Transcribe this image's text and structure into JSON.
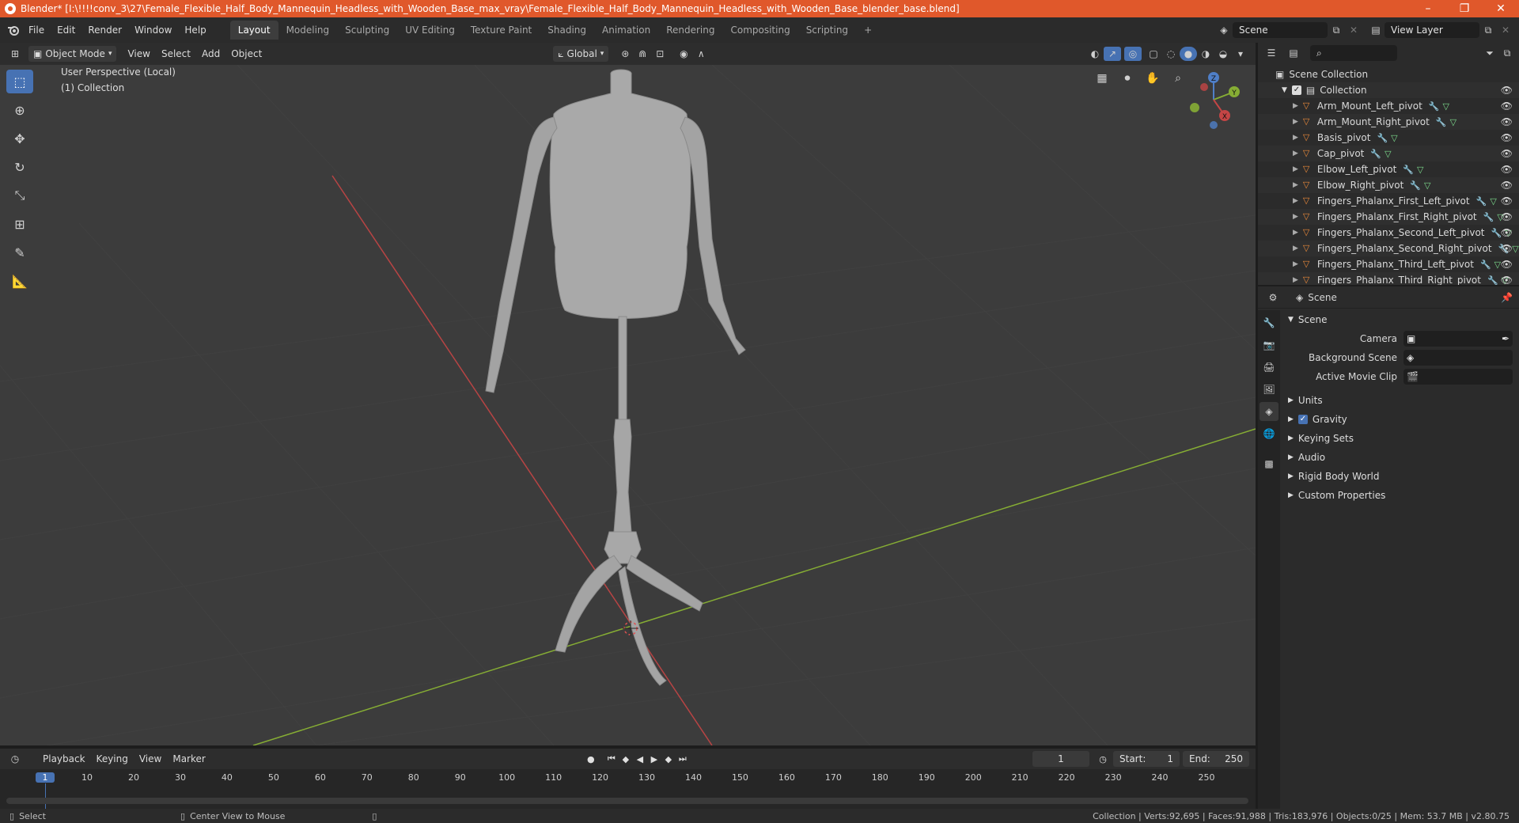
{
  "window": {
    "title": "Blender* [I:\\!!!!conv_3\\27\\Female_Flexible_Half_Body_Mannequin_Headless_with_Wooden_Base_max_vray\\Female_Flexible_Half_Body_Mannequin_Headless_with_Wooden_Base_blender_base.blend]",
    "minimize": "–",
    "maximize": "❐",
    "close": "✕"
  },
  "menu": [
    "File",
    "Edit",
    "Render",
    "Window",
    "Help"
  ],
  "workspaces": [
    "Layout",
    "Modeling",
    "Sculpting",
    "UV Editing",
    "Texture Paint",
    "Shading",
    "Animation",
    "Rendering",
    "Compositing",
    "Scripting"
  ],
  "workspace_add": "+",
  "scene_field": "Scene",
  "view_layer_field": "View Layer",
  "viewport_header": {
    "mode": "Object Mode",
    "menus": [
      "View",
      "Select",
      "Add",
      "Object"
    ],
    "orientation": "Global"
  },
  "viewport": {
    "perspective": "User Perspective (Local)",
    "collection": "(1) Collection",
    "gizmo": {
      "z": "Z",
      "y": "Y",
      "x": "X"
    }
  },
  "outliner": {
    "root": "Scene Collection",
    "collection": "Collection",
    "items": [
      "Arm_Mount_Left_pivot",
      "Arm_Mount_Right_pivot",
      "Basis_pivot",
      "Cap_pivot",
      "Elbow_Left_pivot",
      "Elbow_Right_pivot",
      "Fingers_Phalanx_First_Left_pivot",
      "Fingers_Phalanx_First_Right_pivot",
      "Fingers_Phalanx_Second_Left_pivot",
      "Fingers_Phalanx_Second_Right_pivot",
      "Fingers_Phalanx_Third_Left_pivot",
      "Fingers_Phalanx_Third_Right_pivot"
    ]
  },
  "properties": {
    "context": "Scene",
    "panel": "Scene",
    "camera_label": "Camera",
    "bg_scene_label": "Background Scene",
    "movie_clip_label": "Active Movie Clip",
    "sections": [
      "Units",
      "Gravity",
      "Keying Sets",
      "Audio",
      "Rigid Body World",
      "Custom Properties"
    ]
  },
  "timeline": {
    "menus": [
      "Playback",
      "Keying",
      "View",
      "Marker"
    ],
    "current_frame": "1",
    "start_label": "Start:",
    "start": "1",
    "end_label": "End:",
    "end": "250",
    "ticks": [
      "1",
      "10",
      "20",
      "30",
      "40",
      "50",
      "60",
      "70",
      "80",
      "90",
      "100",
      "110",
      "120",
      "130",
      "140",
      "150",
      "160",
      "170",
      "180",
      "190",
      "200",
      "210",
      "220",
      "230",
      "240",
      "250"
    ]
  },
  "status": {
    "select": "Select",
    "center_view": "Center View to Mouse",
    "stats": "Collection | Verts:92,695 | Faces:91,988 | Tris:183,976 | Objects:0/25 | Mem: 53.7 MB | v2.80.75"
  },
  "colors": {
    "titlebar": "#e0582b",
    "accent": "#4772b3",
    "x_axis": "#c44545",
    "y_axis": "#8cb535",
    "object_icon": "#e8883a"
  }
}
